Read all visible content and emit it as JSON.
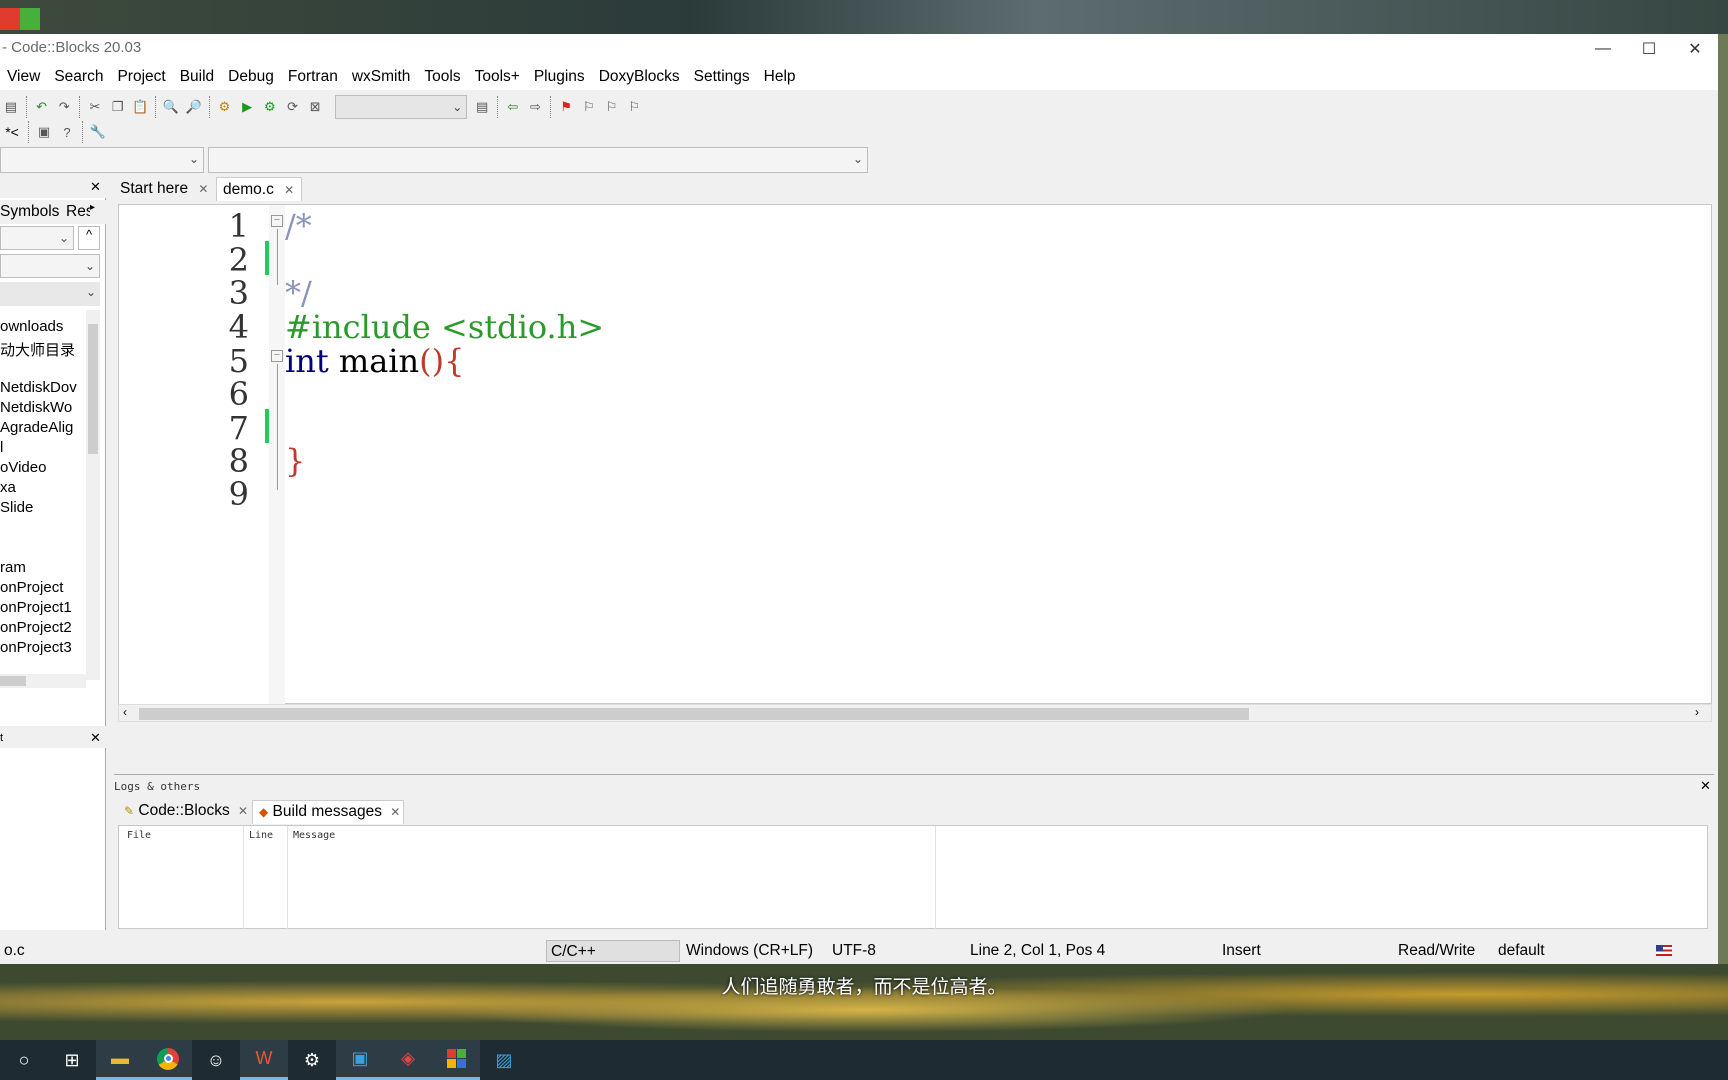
{
  "window": {
    "title": "- Code::Blocks 20.03",
    "minimize": "—",
    "maximize": "☐",
    "close": "✕"
  },
  "menu": [
    "View",
    "Search",
    "Project",
    "Build",
    "Debug",
    "Fortran",
    "wxSmith",
    "Tools",
    "Tools+",
    "Plugins",
    "DoxyBlocks",
    "Settings",
    "Help"
  ],
  "toolbar2": {
    "label": "*<"
  },
  "management": {
    "tabs": [
      "Symbols",
      "Res"
    ],
    "tree_items": [
      "ownloads",
      "动大师目录",
      "NetdiskDov",
      "NetdiskWo",
      "AgradeAlig",
      "l",
      "oVideo",
      "xa",
      "Slide",
      "ram",
      "onProject",
      "onProject1",
      "onProject2",
      "onProject3"
    ],
    "bottom_label": "t"
  },
  "editor": {
    "tabs": [
      "Start here",
      "demo.c"
    ],
    "active_tab": "demo.c",
    "line_numbers": [
      "1",
      "2",
      "3",
      "4",
      "5",
      "6",
      "7",
      "8",
      "9"
    ],
    "code": {
      "l1": "/*",
      "l3": "*/",
      "l4": "#include <stdio.h>",
      "l5_kw": "int",
      "l5_rest": " main",
      "l5_paren": "(){",
      "l8": "}"
    },
    "colors": {
      "comment": "#8a93b8",
      "preproc": "#2a9a2a",
      "keyword": "#00007f",
      "brace": "#c0392b",
      "change_mark": "#22cc55"
    }
  },
  "logs": {
    "title": "Logs & others",
    "tabs": [
      "Code::Blocks",
      "Build messages"
    ],
    "columns": [
      "File",
      "Line",
      "Message"
    ]
  },
  "status": {
    "file": "o.c",
    "language": "C/C++",
    "eol": "Windows (CR+LF)",
    "encoding": "UTF-8",
    "position": "Line 2, Col 1, Pos 4",
    "mode": "Insert",
    "access": "Read/Write",
    "profile": "default"
  },
  "subtitle": "人们追随勇敢者，而不是位高者。"
}
